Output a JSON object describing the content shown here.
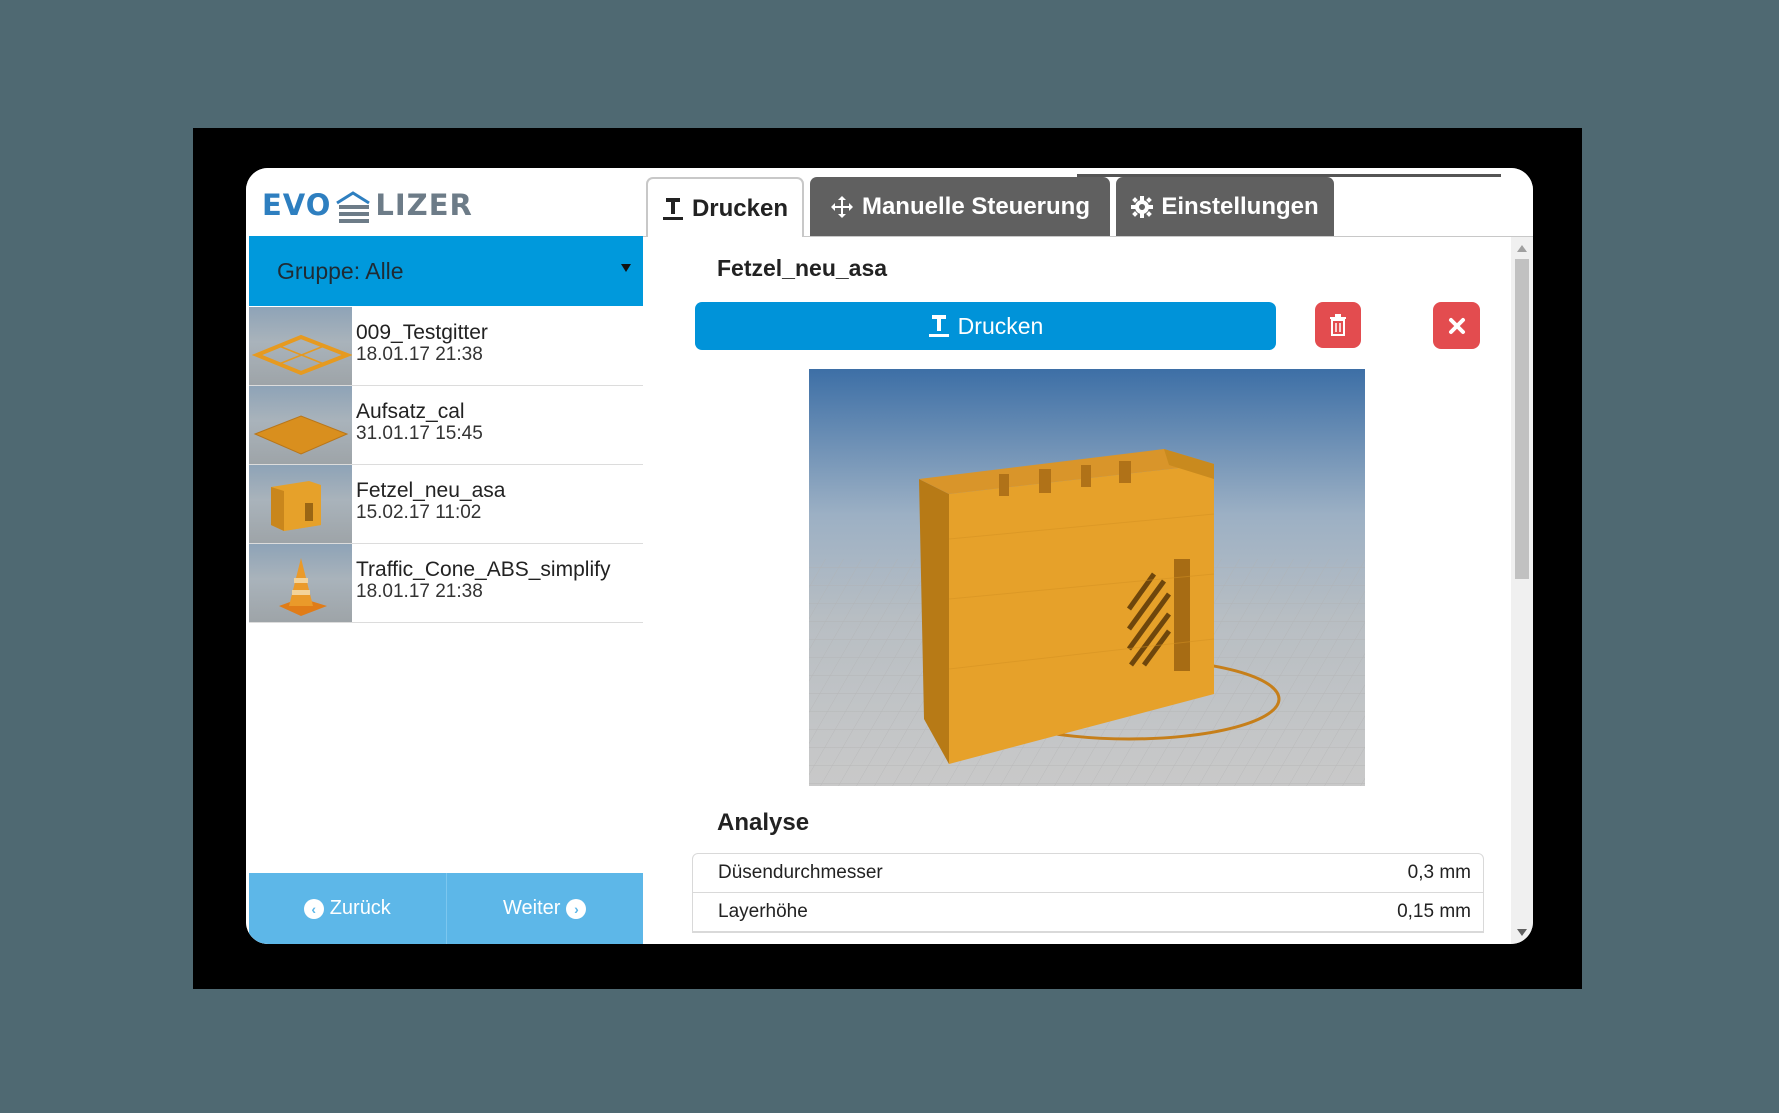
{
  "app": {
    "logo_left": "EVO",
    "logo_right": "LIZER"
  },
  "sidebar": {
    "group_label": "Gruppe: Alle",
    "files": [
      {
        "name": "009_Testgitter",
        "date": "18.01.17 21:38",
        "thumb": "grid-frame"
      },
      {
        "name": "Aufsatz_cal",
        "date": "31.01.17 15:45",
        "thumb": "flat-plate"
      },
      {
        "name": "Fetzel_neu_asa",
        "date": "15.02.17 11:02",
        "thumb": "box"
      },
      {
        "name": "Traffic_Cone_ABS_simplify",
        "date": "18.01.17 21:38",
        "thumb": "cone"
      }
    ],
    "back_label": "Zurück",
    "next_label": "Weiter"
  },
  "tabs": [
    {
      "label": "Drucken",
      "icon": "print-icon",
      "active": true
    },
    {
      "label": "Manuelle Steuerung",
      "icon": "move-arrows-icon",
      "active": false
    },
    {
      "label": "Einstellungen",
      "icon": "gear-icon",
      "active": false
    }
  ],
  "main": {
    "title": "Fetzel_neu_asa",
    "print_button": "Drucken",
    "analysis_heading": "Analyse",
    "analysis_rows": [
      {
        "label": "Düsendurchmesser",
        "value": "0,3 mm"
      },
      {
        "label": "Layerhöhe",
        "value": "0,15 mm"
      }
    ]
  },
  "colors": {
    "accent": "#0093d9",
    "danger": "#e34c4f",
    "model": "#e6a12a",
    "tab_inactive": "#606060"
  }
}
